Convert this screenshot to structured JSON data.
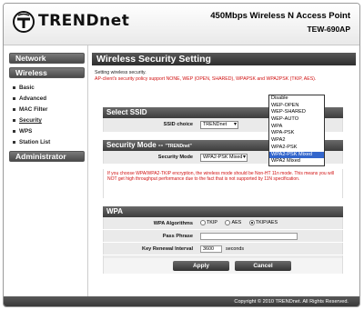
{
  "header": {
    "brand": "TRENDnet",
    "product_title": "450Mbps Wireless N Access Point",
    "model": "TEW-690AP"
  },
  "sidebar": {
    "sections": [
      {
        "label": "Network"
      },
      {
        "label": "Wireless"
      },
      {
        "label": "Administrator"
      }
    ],
    "items": [
      {
        "label": "Basic"
      },
      {
        "label": "Advanced"
      },
      {
        "label": "MAC Filter"
      },
      {
        "label": "Security"
      },
      {
        "label": "WPS"
      },
      {
        "label": "Station List"
      }
    ]
  },
  "main": {
    "title": "Wireless Security Setting",
    "description": "Setting wireless security.",
    "policy_note": "AP-client's security policy support NONE, WEP (OPEN, SHARED), WPAPSK and WPA2PSK (TKIP, AES).",
    "select_ssid": {
      "heading": "Select SSID",
      "label": "SSID choice",
      "value": "TRENDnet"
    },
    "security_mode": {
      "heading": "Security Mode",
      "heading_suffix": "\"TRENDnet\"",
      "label": "Security Mode",
      "value": "WPA2-PSK Mixed",
      "options": [
        "Disable",
        "WEP-OPEN",
        "WEP-SHARED",
        "WEP-AUTO",
        "WPA",
        "WPA-PSK",
        "WPA2",
        "WPA2-PSK",
        "WPA2-PSK Mixed",
        "WPA2 Mixed"
      ],
      "selected_index": 8
    },
    "warning": "If you choose WPA/WPA2-TKIP encryption, the wireless mode should be Non-HT 11n mode. This means you will NOT get high throughput performance due to the fact that is not supported by 11N specification.",
    "wpa": {
      "heading": "WPA",
      "algorithms_label": "WPA Algorithms",
      "algorithms": [
        "TKIP",
        "AES",
        "TKIP/AES"
      ],
      "algorithms_selected": 2,
      "pass_phrase_label": "Pass Phrase",
      "pass_phrase_value": "",
      "renewal_label": "Key Renewal Interval",
      "renewal_value": "3600",
      "renewal_unit": "seconds"
    },
    "buttons": {
      "apply": "Apply",
      "cancel": "Cancel"
    }
  },
  "footer": {
    "copyright": "Copyright © 2010 TRENDnet. All Rights Reserved."
  }
}
